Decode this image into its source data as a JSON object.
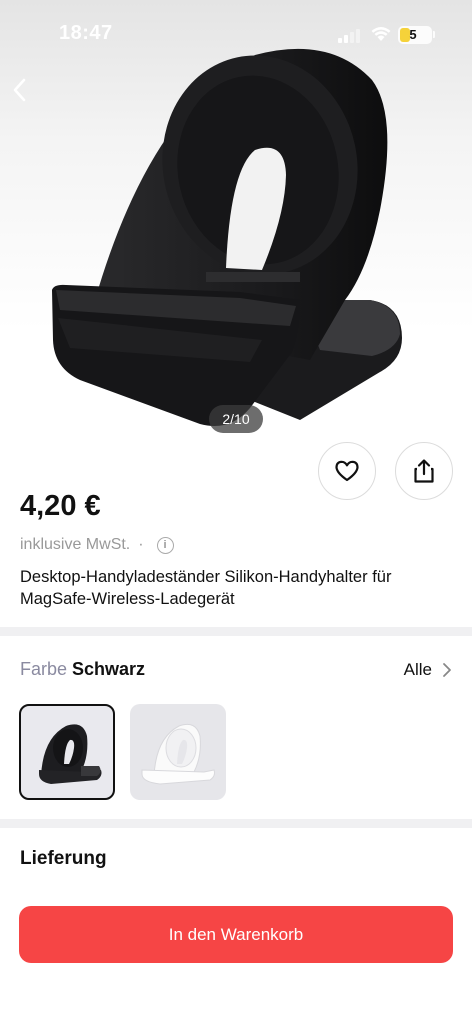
{
  "status_bar": {
    "time": "18:47",
    "battery": "5"
  },
  "gallery": {
    "counter": "2/10"
  },
  "product": {
    "price": "4,20 €",
    "tax_note": "inklusive MwSt.",
    "separator": "·",
    "info_symbol": "i",
    "title": "Desktop-Handyladeständer Silikon-Handyhalter für MagSafe-Wireless-Ladegerät"
  },
  "variant": {
    "label": "Farbe",
    "selected": "Schwarz",
    "all_label": "Alle",
    "options": [
      {
        "name": "Schwarz",
        "color": "#1c1c1e"
      },
      {
        "name": "Weiß",
        "color": "#f4f4f6"
      }
    ]
  },
  "delivery": {
    "label": "Lieferung"
  },
  "cta": {
    "label": "In den Warenkorb",
    "color": "#f64545"
  },
  "icons": {
    "back": "chevron-left-icon",
    "favorite": "heart-icon",
    "share": "share-icon",
    "info": "info-icon",
    "more": "chevron-right-icon"
  }
}
